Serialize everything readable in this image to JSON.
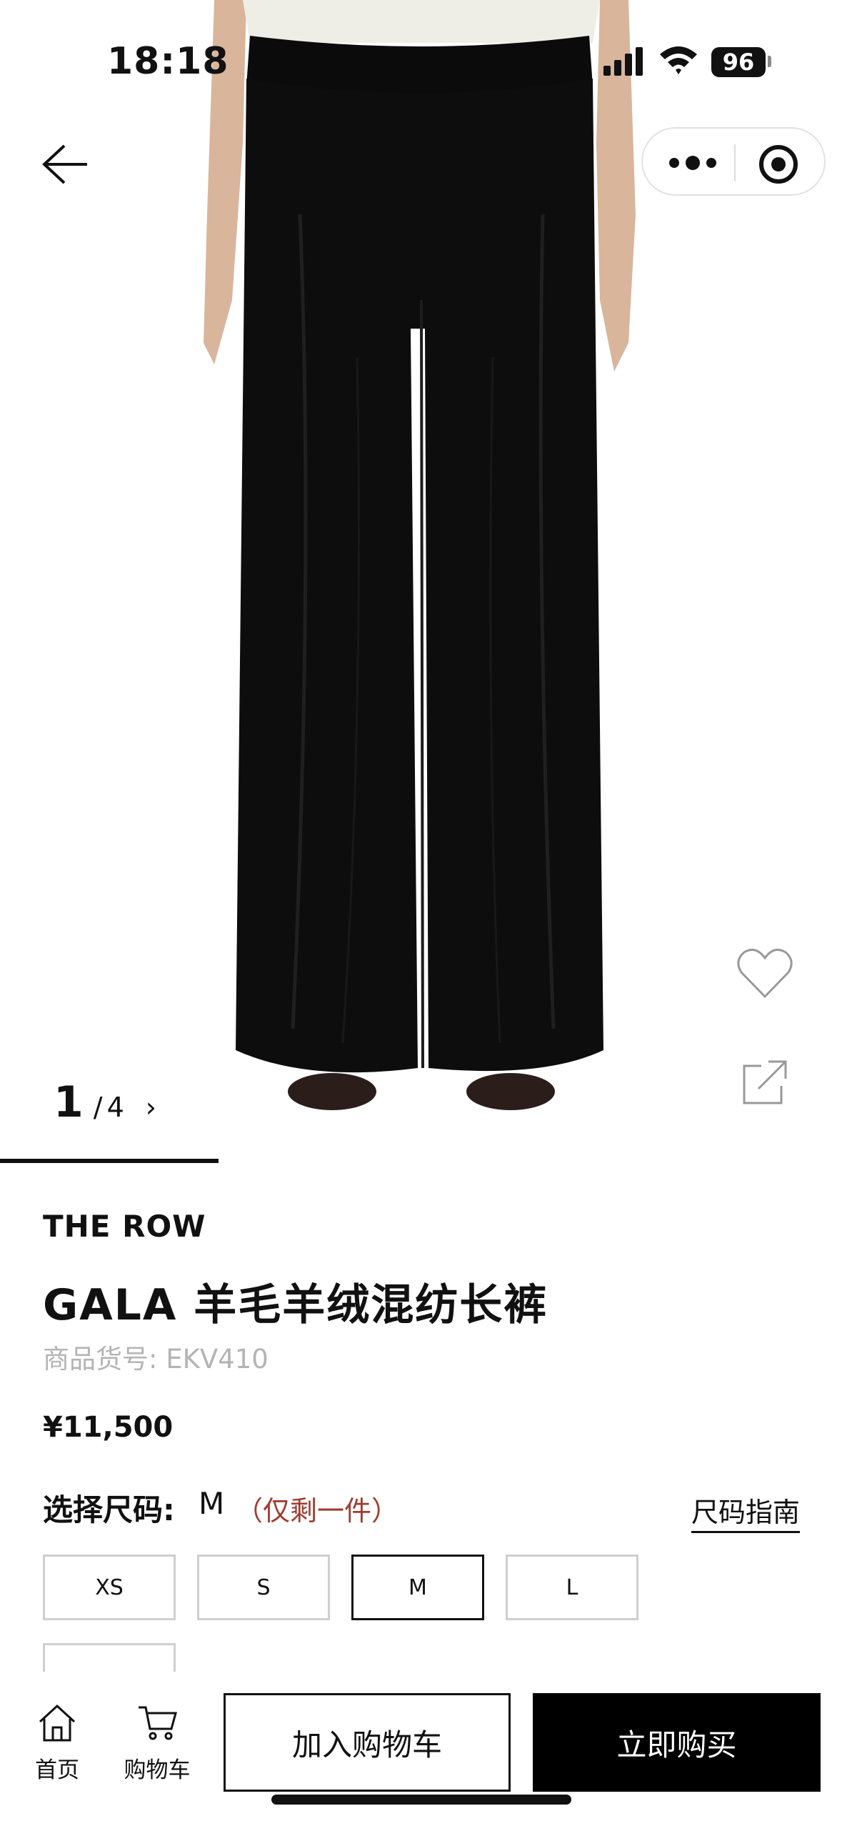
{
  "status_bar": {
    "time": "18:18",
    "battery": "96",
    "icons": [
      "cellular-signal-icon",
      "wifi-icon",
      "battery-icon"
    ]
  },
  "nav": {
    "back_icon": "arrow-left-icon",
    "capsule_icons": [
      "more-dots-icon",
      "target-icon"
    ]
  },
  "gallery": {
    "current": "1",
    "separator": "/",
    "total": "4",
    "next": "›"
  },
  "side_actions": {
    "icons": [
      "heart-icon",
      "share-external-icon"
    ]
  },
  "product": {
    "brand": "THE ROW",
    "title": "GALA 羊毛羊绒混纺长裤",
    "sku_label": "商品货号:",
    "sku_value": "EKV410",
    "price": "¥11,500"
  },
  "size": {
    "label": "选择尺码:",
    "selected": "M",
    "stock_note": "（仅剩一件）",
    "guide": "尺码指南",
    "options": [
      "XS",
      "S",
      "M",
      "L"
    ]
  },
  "bottom_bar": {
    "home_label": "首页",
    "cart_label": "购物车",
    "add_to_cart": "加入购物车",
    "buy_now": "立即购买"
  },
  "colors": {
    "accent": "#000000",
    "stock_note": "#a03b2f",
    "muted_text": "#b4b4b4"
  }
}
